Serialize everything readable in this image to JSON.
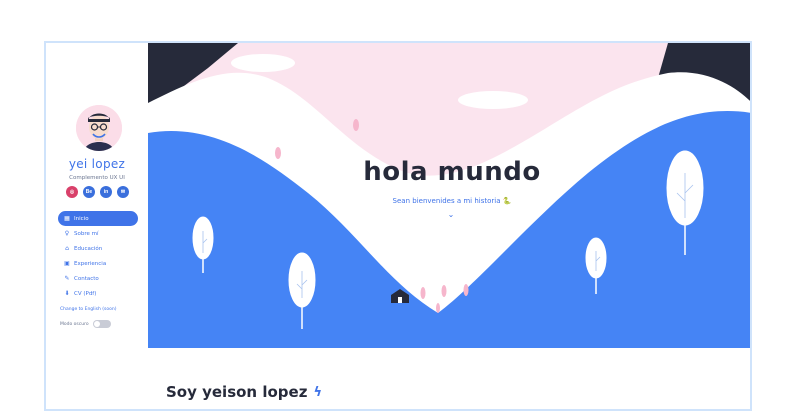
{
  "profile": {
    "name": "yei lopez",
    "subtitle": "Complemento UX UI"
  },
  "socials": [
    {
      "icon": "dribbble-icon",
      "text": "◎"
    },
    {
      "icon": "behance-icon",
      "text": "Be"
    },
    {
      "icon": "linkedin-icon",
      "text": "in"
    },
    {
      "icon": "email-icon",
      "text": "✉"
    }
  ],
  "nav": [
    {
      "label": "Inicio",
      "icon": "▦",
      "active": true
    },
    {
      "label": "Sobre mí",
      "icon": "♀"
    },
    {
      "label": "Educación",
      "icon": "⌂"
    },
    {
      "label": "Experiencia",
      "icon": "▣"
    },
    {
      "label": "Contacto",
      "icon": "✎"
    },
    {
      "label": "CV (Pdf)",
      "icon": "⬇"
    }
  ],
  "settings": {
    "language": "Change to English (soon)",
    "dark_mode": "Modo oscuro"
  },
  "hero": {
    "title": "hola mundo",
    "subtitle": "Sean bienvenides a mi historia 🐍",
    "chevron": "⌄"
  },
  "section": {
    "title": "Soy yeison lopez",
    "icon": "ϟ"
  },
  "colors": {
    "accent": "#3f73e8",
    "sky": "#fbe4ee",
    "dark_mountain": "#262a3a",
    "white_mountain": "#ffffff",
    "blue_hill": "#4584f5"
  }
}
